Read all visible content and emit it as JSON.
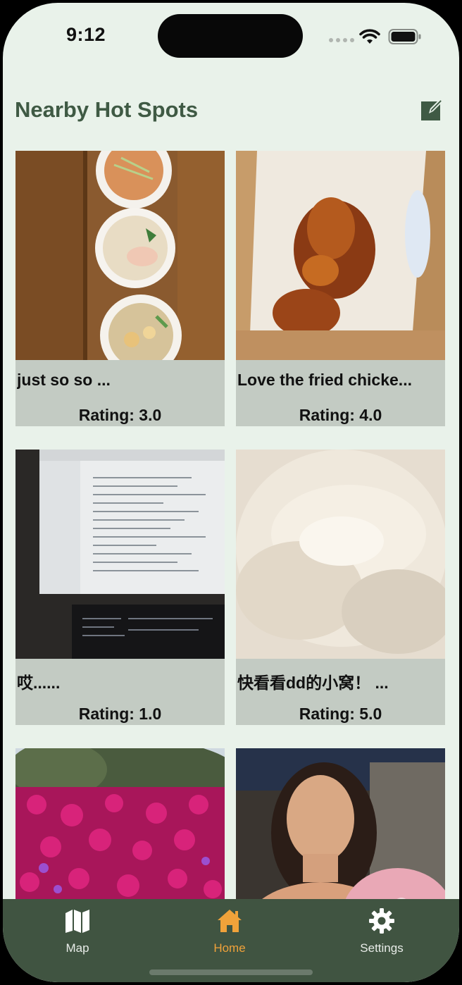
{
  "status_bar": {
    "time": "9:12"
  },
  "header": {
    "title": "Nearby Hot Spots",
    "edit_icon": "compose-icon"
  },
  "posts": [
    {
      "caption": "just so so ...",
      "rating": "Rating: 3.0",
      "photo": "ramen bowls"
    },
    {
      "caption": "Love the fried chicke...",
      "rating": "Rating: 4.0",
      "photo": "fried chicken"
    },
    {
      "caption": "哎......",
      "rating": "Rating: 1.0",
      "photo": "laptop code"
    },
    {
      "caption": "快看看dd的小窝！ ...",
      "rating": "Rating: 5.0",
      "photo": "fluffy bed"
    },
    {
      "caption": "",
      "rating": "",
      "photo": "pink flowers"
    },
    {
      "caption": "",
      "rating": "",
      "photo": "girl with roses"
    }
  ],
  "tabbar": {
    "tabs": [
      {
        "label": "Map",
        "icon": "map-icon",
        "active": false
      },
      {
        "label": "Home",
        "icon": "house-icon",
        "active": true
      },
      {
        "label": "Settings",
        "icon": "gear-icon",
        "active": false
      }
    ]
  },
  "colors": {
    "background": "#e9f2ea",
    "title": "#3f5a44",
    "card": "#c3cbc3",
    "tabbar": "#405441",
    "active_tab": "#f0a23a"
  }
}
